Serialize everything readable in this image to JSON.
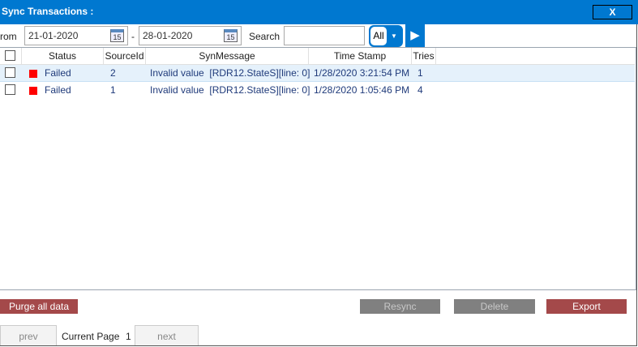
{
  "window": {
    "title": "Sync Transactions :",
    "close_label": "X"
  },
  "filters": {
    "from_label": "rom",
    "from_date": "21-01-2020",
    "separator": "-",
    "to_date": "28-01-2020",
    "calendar_day": "15",
    "search_label": "Search",
    "search_value": "",
    "type_value": "All",
    "go_icon": "play-icon"
  },
  "table": {
    "headers": [
      "Status",
      "SourceId",
      "SynMessage",
      "Time Stamp",
      "Tries"
    ],
    "rows": [
      {
        "status": "Failed",
        "source_id": "2",
        "message": "Invalid value  [RDR12.StateS][line: 0]",
        "timestamp": "1/28/2020 3:21:54 PM",
        "tries": "1",
        "selected": true
      },
      {
        "status": "Failed",
        "source_id": "1",
        "message": "Invalid value  [RDR12.StateS][line: 0]",
        "timestamp": "1/28/2020 1:05:46 PM",
        "tries": "4",
        "selected": false
      }
    ],
    "status_color": "#ff0000"
  },
  "actions": {
    "purge": "Purge all data",
    "resync": "Resync",
    "delete": "Delete",
    "export": "Export"
  },
  "pager": {
    "prev": "prev",
    "label": "Current Page",
    "page": "1",
    "next": "next"
  }
}
